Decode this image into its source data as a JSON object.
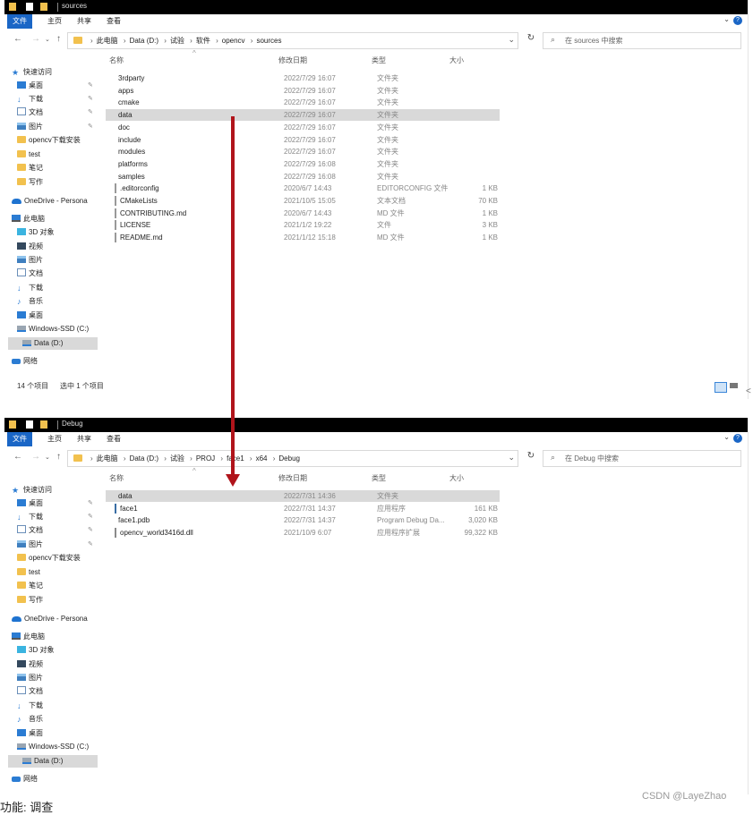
{
  "windows": [
    {
      "title": "sources",
      "ribbon_tabs": [
        "文件",
        "主页",
        "共享",
        "查看"
      ],
      "breadcrumbs": [
        "此电脑",
        "Data (D:)",
        "试验",
        "软件",
        "opencv",
        "sources"
      ],
      "search_placeholder": "在 sources 中搜索",
      "columns": {
        "name": "名称",
        "date": "修改日期",
        "type": "类型",
        "size": "大小"
      },
      "sidebar": [
        {
          "label": "快速访问",
          "icon": "star-icon"
        },
        {
          "label": "桌面",
          "icon": "desktop-icon",
          "pinned": true
        },
        {
          "label": "下载",
          "icon": "download-icon",
          "pinned": true
        },
        {
          "label": "文档",
          "icon": "document-icon",
          "pinned": true
        },
        {
          "label": "图片",
          "icon": "picture-icon",
          "pinned": true
        },
        {
          "label": "opencv下载安装",
          "icon": "folder-icon"
        },
        {
          "label": "test",
          "icon": "folder-icon"
        },
        {
          "label": "笔记",
          "icon": "folder-icon"
        },
        {
          "label": "写作",
          "icon": "folder-icon"
        },
        {
          "label": "OneDrive - Persona",
          "icon": "onedrive-icon"
        },
        {
          "label": "此电脑",
          "icon": "computer-icon"
        },
        {
          "label": "3D 对象",
          "icon": "cube-icon"
        },
        {
          "label": "视频",
          "icon": "video-icon"
        },
        {
          "label": "图片",
          "icon": "picture-icon"
        },
        {
          "label": "文档",
          "icon": "document-icon"
        },
        {
          "label": "下载",
          "icon": "download-icon"
        },
        {
          "label": "音乐",
          "icon": "music-icon"
        },
        {
          "label": "桌面",
          "icon": "desktop-icon"
        },
        {
          "label": "Windows-SSD (C:)",
          "icon": "drive-icon"
        },
        {
          "label": "Data (D:)",
          "icon": "drive-icon",
          "selected": true
        },
        {
          "label": "网络",
          "icon": "network-icon"
        }
      ],
      "files": [
        {
          "name": "3rdparty",
          "date": "2022/7/29 16:07",
          "type": "文件夹",
          "size": "",
          "icon": "folder-icon"
        },
        {
          "name": "apps",
          "date": "2022/7/29 16:07",
          "type": "文件夹",
          "size": "",
          "icon": "folder-icon"
        },
        {
          "name": "cmake",
          "date": "2022/7/29 16:07",
          "type": "文件夹",
          "size": "",
          "icon": "folder-icon"
        },
        {
          "name": "data",
          "date": "2022/7/29 16:07",
          "type": "文件夹",
          "size": "",
          "icon": "folder-icon",
          "selected": true
        },
        {
          "name": "doc",
          "date": "2022/7/29 16:07",
          "type": "文件夹",
          "size": "",
          "icon": "folder-icon"
        },
        {
          "name": "include",
          "date": "2022/7/29 16:07",
          "type": "文件夹",
          "size": "",
          "icon": "folder-icon"
        },
        {
          "name": "modules",
          "date": "2022/7/29 16:07",
          "type": "文件夹",
          "size": "",
          "icon": "folder-icon"
        },
        {
          "name": "platforms",
          "date": "2022/7/29 16:08",
          "type": "文件夹",
          "size": "",
          "icon": "folder-icon"
        },
        {
          "name": "samples",
          "date": "2022/7/29 16:08",
          "type": "文件夹",
          "size": "",
          "icon": "folder-icon"
        },
        {
          "name": ".editorconfig",
          "date": "2020/6/7 14:43",
          "type": "EDITORCONFIG 文件",
          "size": "1 KB",
          "icon": "file-icon"
        },
        {
          "name": "CMakeLists",
          "date": "2021/10/5 15:05",
          "type": "文本文档",
          "size": "70 KB",
          "icon": "file-icon"
        },
        {
          "name": "CONTRIBUTING.md",
          "date": "2020/6/7 14:43",
          "type": "MD 文件",
          "size": "1 KB",
          "icon": "file-icon"
        },
        {
          "name": "LICENSE",
          "date": "2021/1/2 19:22",
          "type": "文件",
          "size": "3 KB",
          "icon": "file-icon"
        },
        {
          "name": "README.md",
          "date": "2021/1/12 15:18",
          "type": "MD 文件",
          "size": "1 KB",
          "icon": "file-icon"
        }
      ],
      "status_count": "14 个项目",
      "status_selected": "选中 1 个项目"
    },
    {
      "title": "Debug",
      "ribbon_tabs": [
        "文件",
        "主页",
        "共享",
        "查看"
      ],
      "breadcrumbs": [
        "此电脑",
        "Data (D:)",
        "试验",
        "PROJ",
        "face1",
        "x64",
        "Debug"
      ],
      "search_placeholder": "在 Debug 中搜索",
      "columns": {
        "name": "名称",
        "date": "修改日期",
        "type": "类型",
        "size": "大小"
      },
      "sidebar": [
        {
          "label": "快速访问",
          "icon": "star-icon"
        },
        {
          "label": "桌面",
          "icon": "desktop-icon",
          "pinned": true
        },
        {
          "label": "下载",
          "icon": "download-icon",
          "pinned": true
        },
        {
          "label": "文档",
          "icon": "document-icon",
          "pinned": true
        },
        {
          "label": "图片",
          "icon": "picture-icon",
          "pinned": true
        },
        {
          "label": "opencv下载安装",
          "icon": "folder-icon"
        },
        {
          "label": "test",
          "icon": "folder-icon"
        },
        {
          "label": "笔记",
          "icon": "folder-icon"
        },
        {
          "label": "写作",
          "icon": "folder-icon"
        },
        {
          "label": "OneDrive - Persona",
          "icon": "onedrive-icon"
        },
        {
          "label": "此电脑",
          "icon": "computer-icon"
        },
        {
          "label": "3D 对象",
          "icon": "cube-icon"
        },
        {
          "label": "视频",
          "icon": "video-icon"
        },
        {
          "label": "图片",
          "icon": "picture-icon"
        },
        {
          "label": "文档",
          "icon": "document-icon"
        },
        {
          "label": "下载",
          "icon": "download-icon"
        },
        {
          "label": "音乐",
          "icon": "music-icon"
        },
        {
          "label": "桌面",
          "icon": "desktop-icon"
        },
        {
          "label": "Windows-SSD (C:)",
          "icon": "drive-icon"
        },
        {
          "label": "Data (D:)",
          "icon": "drive-icon",
          "selected": true
        },
        {
          "label": "网络",
          "icon": "network-icon"
        }
      ],
      "files": [
        {
          "name": "data",
          "date": "2022/7/31 14:36",
          "type": "文件夹",
          "size": "",
          "icon": "folder-icon",
          "selected": true
        },
        {
          "name": "face1",
          "date": "2022/7/31 14:37",
          "type": "应用程序",
          "size": "161 KB",
          "icon": "exe-icon"
        },
        {
          "name": "face1.pdb",
          "date": "2022/7/31 14:37",
          "type": "Program Debug Da...",
          "size": "3,020 KB",
          "icon": "pdb-icon"
        },
        {
          "name": "opencv_world3416d.dll",
          "date": "2021/10/9 6:07",
          "type": "应用程序扩展",
          "size": "99,322 KB",
          "icon": "dll-icon"
        }
      ]
    }
  ],
  "caption": "功能: 调查",
  "watermark": "CSDN @LayeZhao",
  "edge_glyph": "<",
  "colors": {
    "accent": "#1a66c6",
    "arrow": "#b0141b",
    "selection": "#d9d9d9",
    "folder": "#f2c14e"
  }
}
